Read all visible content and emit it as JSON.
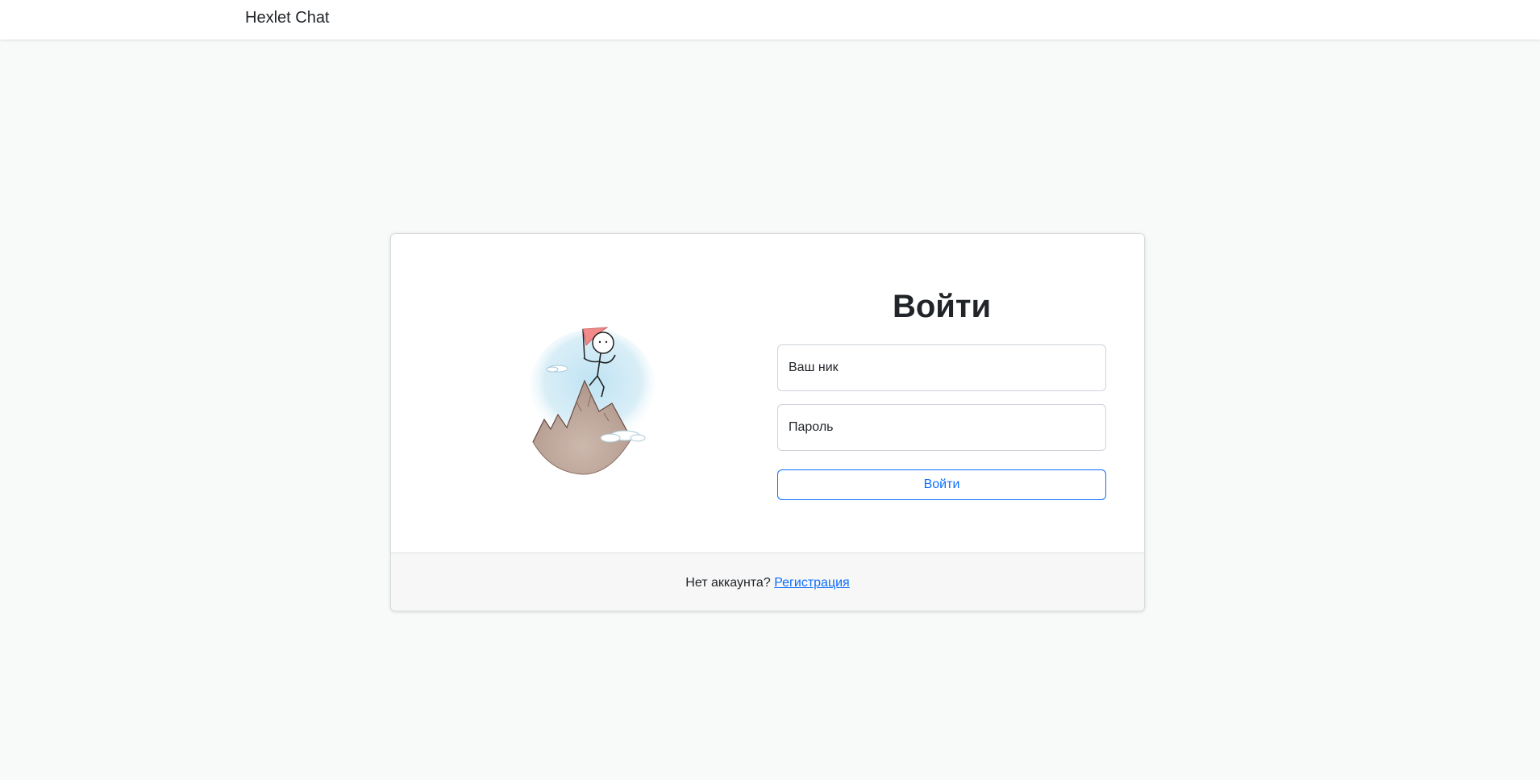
{
  "navbar": {
    "brand": "Hexlet Chat"
  },
  "login": {
    "title": "Войти",
    "username_placeholder": "Ваш ник",
    "password_placeholder": "Пароль",
    "submit_label": "Войти",
    "illustration_icon": "mountain-climber-illustration"
  },
  "footer": {
    "prompt": "Нет аккаунта?",
    "signup_link": "Регистрация"
  },
  "colors": {
    "accent": "#0d6efd",
    "background": "#f8f9f9",
    "card": "#ffffff",
    "footer_bg": "#f7f7f7"
  }
}
